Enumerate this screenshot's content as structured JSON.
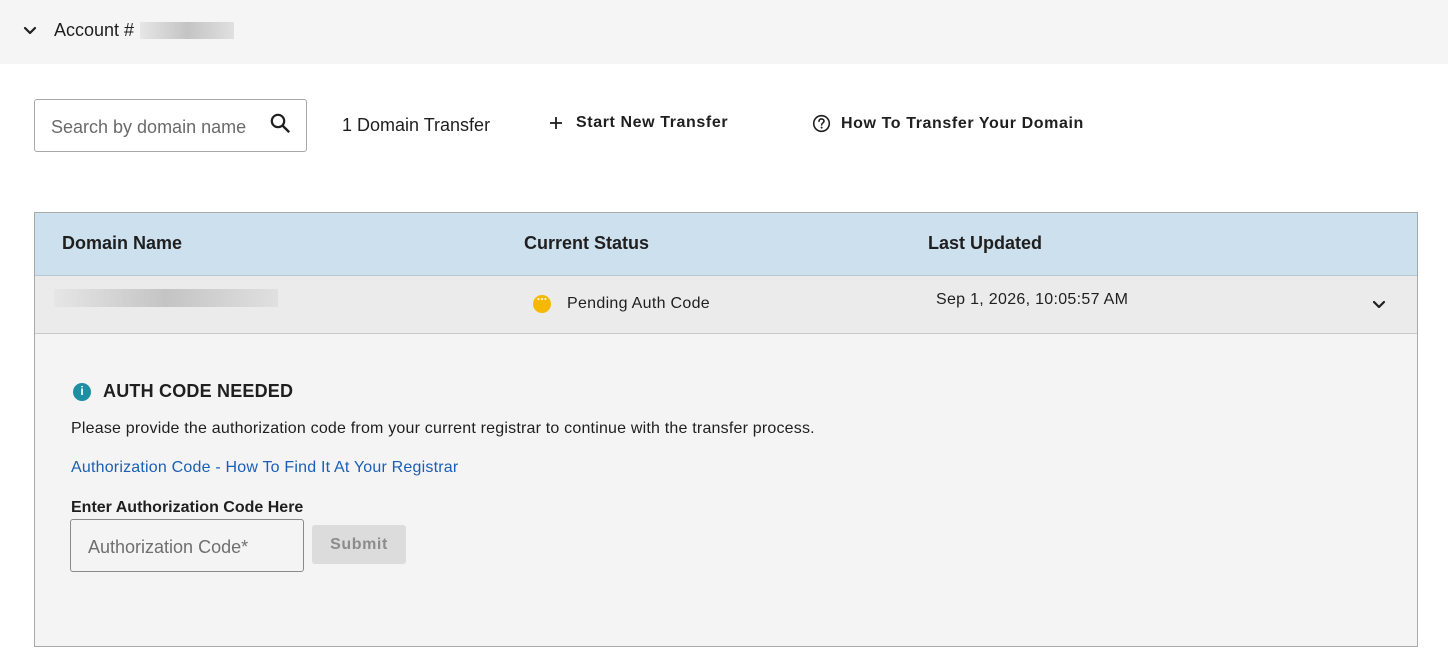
{
  "account": {
    "label": "Account #",
    "expand_icon": "chevron-down-icon"
  },
  "toolbar": {
    "search_placeholder": "Search by domain name",
    "search_value": "",
    "search_icon": "search-icon",
    "transfer_count": "1 Domain Transfer",
    "start_transfer_label": "Start New Transfer",
    "start_transfer_icon": "plus-icon",
    "howto_label": "How To Transfer Your Domain",
    "howto_icon": "question-circle-icon"
  },
  "table": {
    "headers": {
      "domain": "Domain Name",
      "status": "Current Status",
      "updated": "Last Updated"
    },
    "rows": [
      {
        "status": "Pending Auth Code",
        "status_color": "#f6b800",
        "updated": "Sep 1, 2026, 10:05:57 AM",
        "expanded": true
      }
    ]
  },
  "auth_panel": {
    "title": "AUTH CODE NEEDED",
    "description": "Please provide the authorization code from your current registrar to continue with the transfer process.",
    "link_text": "Authorization Code - How To Find It At Your Registrar",
    "field_label": "Enter Authorization Code Here",
    "input_placeholder": "Authorization Code*",
    "input_value": "",
    "submit_label": "Submit",
    "submit_disabled": true
  },
  "colors": {
    "header_bg": "#cce0ee",
    "link": "#1a5fb4",
    "info": "#1f8ea3",
    "pending": "#f6b800"
  }
}
